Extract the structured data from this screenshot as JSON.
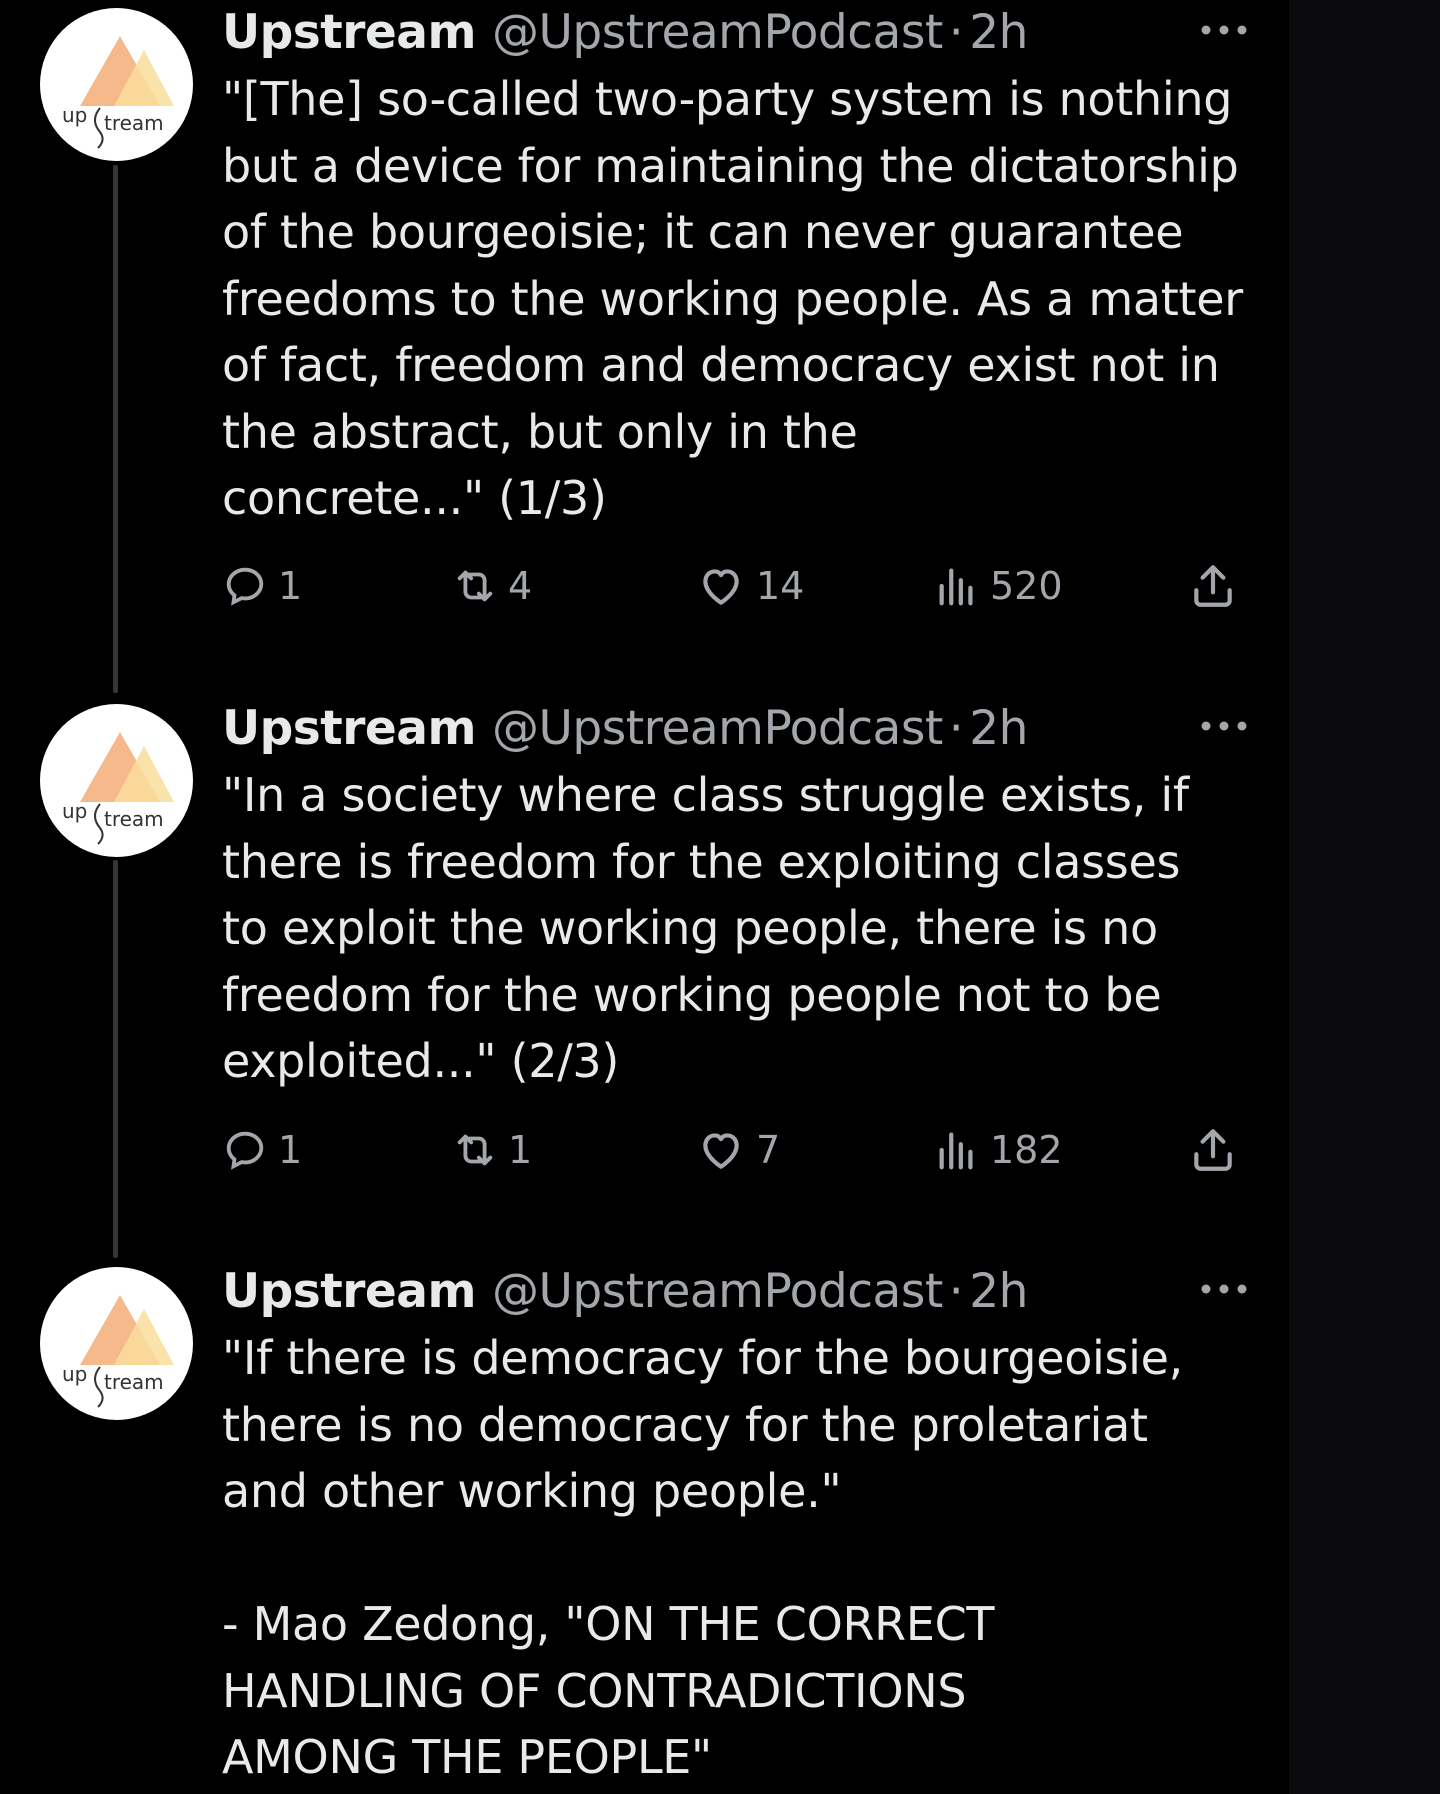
{
  "colors": {
    "background": "#000000",
    "text_primary": "#e7e9ea",
    "text_secondary": "#a3a7ab",
    "thread_line": "#333639",
    "avatar_peach": "#f6b98c",
    "avatar_yellow": "#f9dd9c"
  },
  "tweets": [
    {
      "name": "Upstream",
      "handle": "@UpstreamPodcast",
      "separator": "·",
      "time": "2h",
      "avatar_text_left": "up",
      "avatar_text_right": "tream",
      "text": "\"[The] so-called two-party system is nothing\nbut a device for maintaining the dictatorship\nof the bourgeoisie; it can never guarantee\nfreedoms to the working people. As a matter\nof fact, freedom and democracy exist not in\nthe abstract, but only in the\nconcrete...\" (1/3)",
      "replies": "1",
      "reposts": "4",
      "likes": "14",
      "views": "520"
    },
    {
      "name": "Upstream",
      "handle": "@UpstreamPodcast",
      "separator": "·",
      "time": "2h",
      "avatar_text_left": "up",
      "avatar_text_right": "tream",
      "text": "\"In a society where class struggle exists, if\nthere is freedom for the exploiting classes\nto exploit the working people, there is no\nfreedom for the working people not to be\nexploited...\" (2/3)",
      "replies": "1",
      "reposts": "1",
      "likes": "7",
      "views": "182"
    },
    {
      "name": "Upstream",
      "handle": "@UpstreamPodcast",
      "separator": "·",
      "time": "2h",
      "avatar_text_left": "up",
      "avatar_text_right": "tream",
      "text": "\"If there is democracy for the bourgeoisie,\nthere is no democracy for the proletariat\nand other working people.\"\n\n- Mao Zedong, \"ON THE CORRECT\nHANDLING OF CONTRADICTIONS\nAMONG THE PEOPLE\""
    }
  ],
  "icons": {
    "reply": "reply-icon",
    "repost": "repost-icon",
    "like": "heart-icon",
    "views": "views-icon",
    "share": "share-icon",
    "more": "more-icon"
  }
}
